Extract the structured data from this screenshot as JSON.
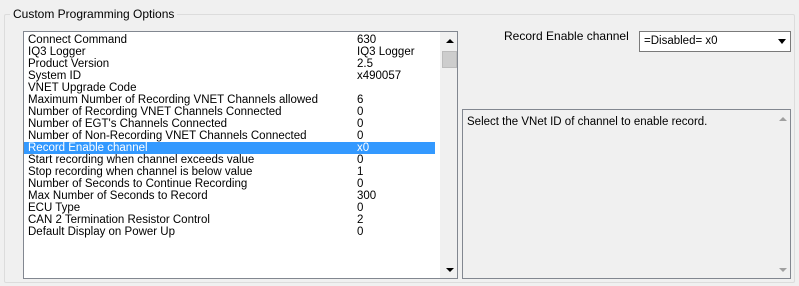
{
  "group": {
    "title": "Custom Programming Options"
  },
  "options": [
    {
      "name": "Connect Command",
      "value": "630"
    },
    {
      "name": "IQ3 Logger",
      "value": "IQ3 Logger"
    },
    {
      "name": "Product Version",
      "value": "2.5"
    },
    {
      "name": "System ID",
      "value": "x490057"
    },
    {
      "name": "VNET Upgrade Code",
      "value": ""
    },
    {
      "name": "Maximum Number of Recording VNET Channels allowed",
      "value": "6"
    },
    {
      "name": "Number of Recording VNET Channels Connected",
      "value": "0"
    },
    {
      "name": "Number of EGT's Channels Connected",
      "value": "0"
    },
    {
      "name": "Number of Non-Recording VNET Channels Connected",
      "value": "0"
    },
    {
      "name": "Record Enable channel",
      "value": "x0"
    },
    {
      "name": "Start recording when channel exceeds value",
      "value": "0"
    },
    {
      "name": "Stop recording when channel is below value",
      "value": "1"
    },
    {
      "name": "Number of Seconds to Continue Recording",
      "value": "0"
    },
    {
      "name": "Max Number of Seconds to Record",
      "value": "300"
    },
    {
      "name": "ECU Type",
      "value": "0"
    },
    {
      "name": "CAN 2 Termination Resistor Control",
      "value": "2"
    },
    {
      "name": "Default Display on Power Up",
      "value": "0"
    }
  ],
  "selected_index": 9,
  "record_enable": {
    "label": "Record Enable channel",
    "value": "=Disabled= x0"
  },
  "description": "Select the VNet ID of channel to enable record.",
  "colors": {
    "selection": "#3399ff",
    "selection_text": "#ffffff",
    "background": "#f0f0f0"
  },
  "icons": {
    "scroll_up": "triangle-up",
    "scroll_down": "triangle-down",
    "combo_dropdown": "triangle-down"
  }
}
